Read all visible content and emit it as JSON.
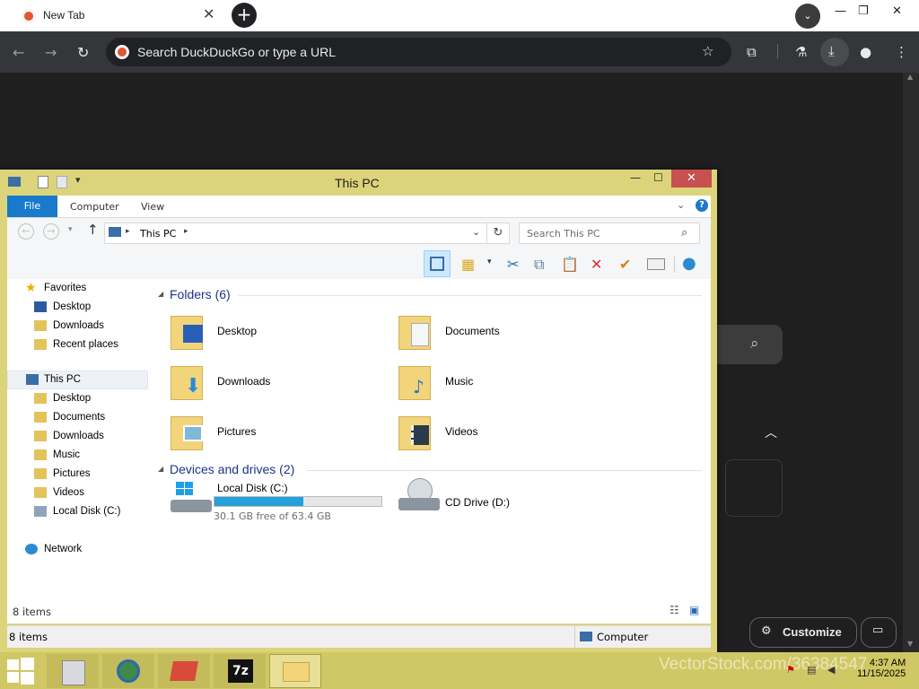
{
  "browser": {
    "tab_title": "New Tab",
    "omnibox_placeholder": "Search DuckDuckGo or type a URL",
    "customize_label": "Customize"
  },
  "explorer": {
    "title": "This PC",
    "ribbon_tabs": [
      "File",
      "Computer",
      "View"
    ],
    "address": "This PC",
    "search_placeholder": "Search This PC",
    "nav": {
      "favorites": "Favorites",
      "favorites_items": [
        "Desktop",
        "Downloads",
        "Recent places"
      ],
      "this_pc": "This PC",
      "this_pc_items": [
        "Desktop",
        "Documents",
        "Downloads",
        "Music",
        "Pictures",
        "Videos",
        "Local Disk (C:)"
      ],
      "network": "Network"
    },
    "folders_header": "Folders (6)",
    "folders": [
      "Desktop",
      "Documents",
      "Downloads",
      "Music",
      "Pictures",
      "Videos"
    ],
    "devices_header": "Devices and drives (2)",
    "drives": [
      {
        "name": "Local Disk (C:)",
        "free_text": "30.1 GB free of 63.4 GB",
        "used_fraction": 0.53
      },
      {
        "name": "CD Drive (D:)"
      }
    ],
    "item_count": "8 items",
    "status_left": "8 items",
    "status_right": "Computer"
  },
  "taskbar": {
    "time": "4:37 AM",
    "date": "11/15/2025",
    "watermark": "VectorStock.com/36384547"
  },
  "colors": {
    "window_frame": "#dcd47a",
    "file_tab": "#1979ca",
    "close_button": "#c75050",
    "progress": "#26a0da"
  }
}
